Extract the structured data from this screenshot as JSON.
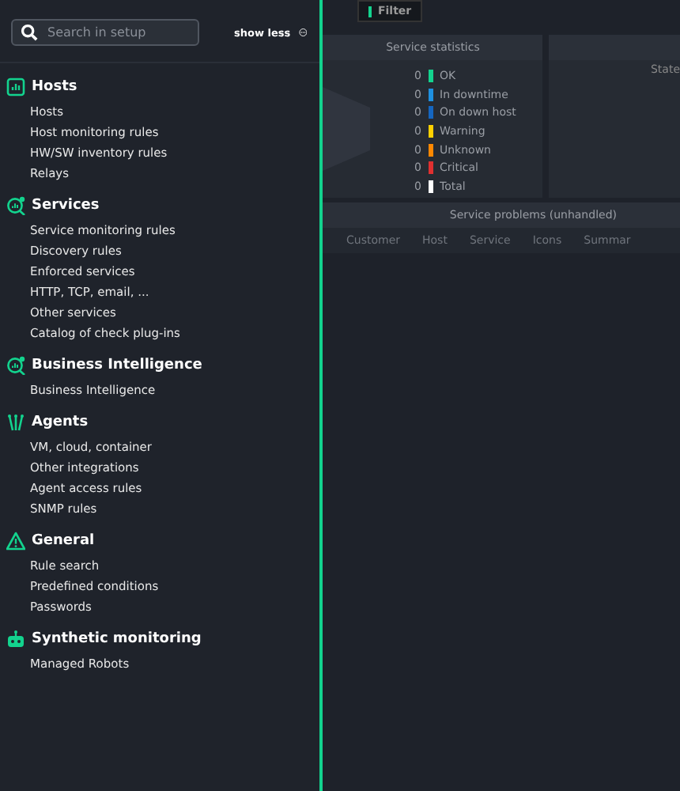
{
  "search": {
    "placeholder": "Search in setup"
  },
  "toggle": {
    "label": "show less"
  },
  "groups": [
    {
      "title": "Hosts",
      "items": [
        "Hosts",
        "Host monitoring rules",
        "HW/SW inventory rules",
        "Relays"
      ]
    },
    {
      "title": "Services",
      "items": [
        "Service monitoring rules",
        "Discovery rules",
        "Enforced services",
        "HTTP, TCP, email, ...",
        "Other services",
        "Catalog of check plug-ins"
      ]
    },
    {
      "title": "Business Intelligence",
      "items": [
        "Business Intelligence"
      ]
    },
    {
      "title": "Agents",
      "items": [
        "VM, cloud, container",
        "Other integrations",
        "Agent access rules",
        "SNMP rules"
      ]
    },
    {
      "title": "General",
      "items": [
        "Rule search",
        "Predefined conditions",
        "Passwords"
      ]
    },
    {
      "title": "Synthetic monitoring",
      "items": [
        "Managed Robots"
      ]
    }
  ],
  "background": {
    "filter_button": "Filter",
    "stats": {
      "title": "Service statistics",
      "rows": [
        {
          "count": "0",
          "label": "OK",
          "color": "#13d38e"
        },
        {
          "count": "0",
          "label": "In downtime",
          "color": "#1e90e0"
        },
        {
          "count": "0",
          "label": "On down host",
          "color": "#1566c0"
        },
        {
          "count": "0",
          "label": "Warning",
          "color": "#ffd000"
        },
        {
          "count": "0",
          "label": "Unknown",
          "color": "#ff8800"
        },
        {
          "count": "0",
          "label": "Critical",
          "color": "#e03030"
        },
        {
          "count": "0",
          "label": "Total",
          "color": "#ffffff"
        }
      ]
    },
    "state_panel": {
      "label": "State"
    },
    "problems": {
      "title": "Service problems (unhandled)",
      "columns": [
        "Customer",
        "Host",
        "Service",
        "Icons",
        "Summar"
      ]
    }
  }
}
